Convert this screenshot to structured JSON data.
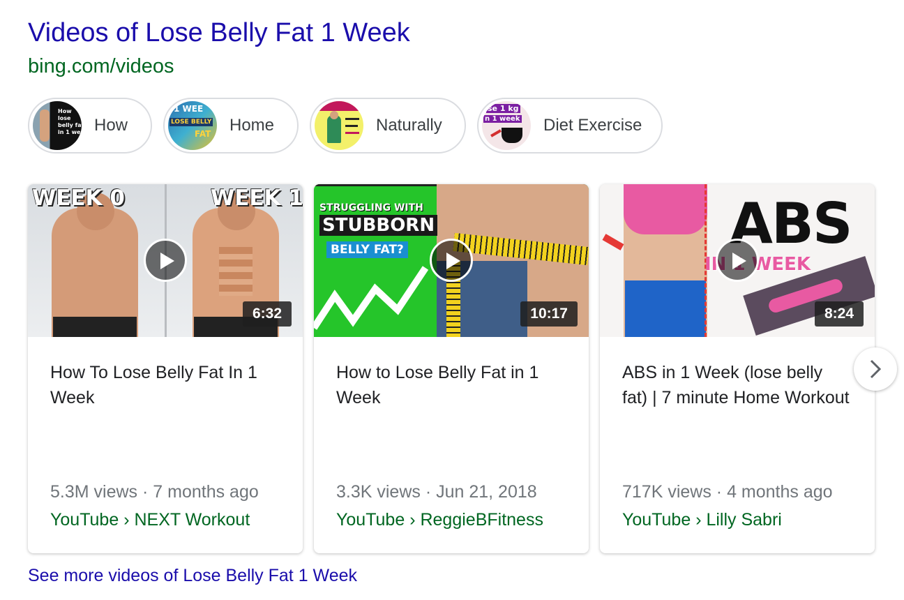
{
  "header": {
    "title": "Videos of Lose Belly Fat 1 Week",
    "source": "bing.com/videos"
  },
  "chips": [
    {
      "label": "How",
      "thumb_text": [
        "How",
        "lose",
        "belly fat",
        "in 1 wee"
      ]
    },
    {
      "label": "Home",
      "thumb_text": [
        "1 WEE",
        "LOSE BELLY",
        "FAT"
      ]
    },
    {
      "label": "Naturally"
    },
    {
      "label": "Diet Exercise",
      "thumb_text": [
        "se 1 kg",
        "n 1 week"
      ]
    }
  ],
  "videos": [
    {
      "title": "How To Lose Belly Fat In 1 Week",
      "duration": "6:32",
      "views": "5.3M views",
      "age": "7 months ago",
      "source": "YouTube",
      "channel": "NEXT Workout",
      "thumb_text": [
        "WEEK 0",
        "WEEK 1"
      ]
    },
    {
      "title": "How to Lose Belly Fat in 1 Week",
      "duration": "10:17",
      "views": "3.3K views",
      "age": "Jun 21, 2018",
      "source": "YouTube",
      "channel": "ReggieBFitness",
      "thumb_text": [
        "STRUGGLING WITH",
        "STUBBORN",
        "BELLY FAT?"
      ]
    },
    {
      "title": "ABS in 1 Week (lose belly fat) | 7 minute Home Workout",
      "duration": "8:24",
      "views": "717K views",
      "age": "4 months ago",
      "source": "YouTube",
      "channel": "Lilly Sabri",
      "thumb_text": [
        "ABS",
        "IN 1 WEEK"
      ]
    }
  ],
  "separators": {
    "dot": " · ",
    "crumb": " › "
  },
  "footer": {
    "see_more": "See more videos of Lose Belly Fat 1 Week"
  },
  "colors": {
    "link": "#1a0dab",
    "url_green": "#006621",
    "meta_gray": "#70757a"
  },
  "icons": {
    "play": "play-icon",
    "next": "chevron-right-icon"
  }
}
